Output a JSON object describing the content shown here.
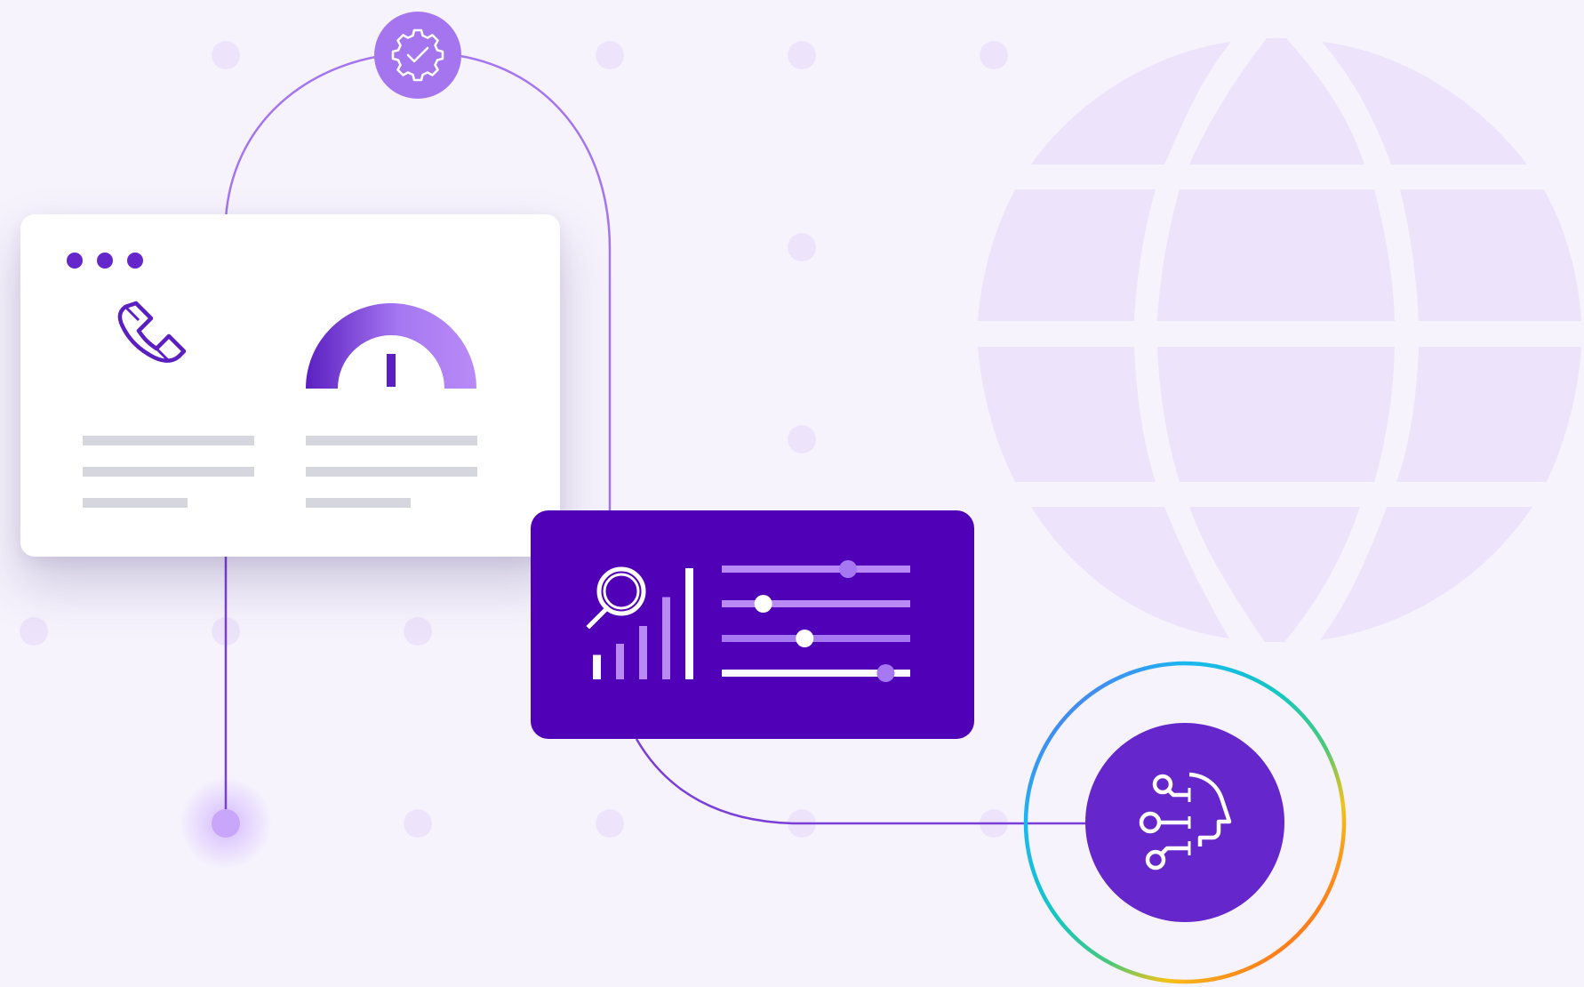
{
  "colors": {
    "background": "#f6f3fd",
    "card": "#ffffff",
    "brand_purple": "#6527cc",
    "deep_purple": "#5001b8",
    "lavender": "#ede4fb",
    "gauge_start": "#5b1fc1",
    "gauge_end": "#b98af6",
    "skeleton_line": "#d6d7de",
    "connector": "#a575f0"
  },
  "icons": {
    "settings_node": "gear-check-icon",
    "browser_controls": "window-dots-icon",
    "phone": "phone-icon",
    "gauge": "speedometer-gauge-icon",
    "search": "magnifier-icon",
    "bars": "bar-chart-icon",
    "sliders": "sliders-icon",
    "ai_head": "ai-circuit-head-icon",
    "globe": "globe-icon",
    "ring": "gradient-ring"
  },
  "analytics": {
    "slider_levels": [
      0.67,
      0.22,
      0.44,
      0.87
    ],
    "bar_levels": [
      0.22,
      0.32,
      0.48,
      0.74,
      1.0
    ]
  }
}
